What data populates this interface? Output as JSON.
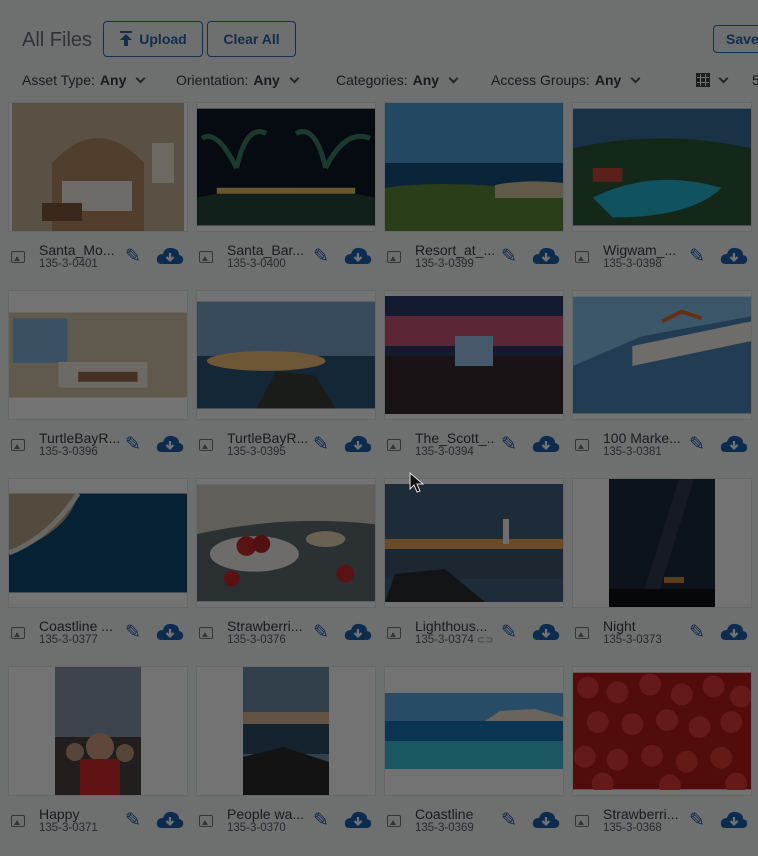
{
  "header": {
    "title": "All Files",
    "upload_label": "Upload",
    "clear_label": "Clear All",
    "save_label": "Save"
  },
  "filters": [
    {
      "label": "Asset Type:",
      "value": "Any"
    },
    {
      "label": "Orientation:",
      "value": "Any"
    },
    {
      "label": "Categories:",
      "value": "Any"
    },
    {
      "label": "Access Groups:",
      "value": "Any"
    }
  ],
  "view": {
    "icon": "grid-icon",
    "per_page": "5"
  },
  "colors": {
    "accent": "#1e5fae",
    "overlay": "rgba(0,0,0,0.55)"
  },
  "files": [
    {
      "name": "Santa_Mo...",
      "code": "135-3-0401"
    },
    {
      "name": "Santa_Bar...",
      "code": "135-3-0400"
    },
    {
      "name": "Resort_at_...",
      "code": "135-3-0399"
    },
    {
      "name": "Wigwam_...",
      "code": "135-3-0398"
    },
    {
      "name": "TurtleBayR...",
      "code": "135-3-0396"
    },
    {
      "name": "TurtleBayR...",
      "code": "135-3-0395"
    },
    {
      "name": "The_Scott_...",
      "code": "135-3-0394"
    },
    {
      "name": "100 Marke...",
      "code": "135-3-0381"
    },
    {
      "name": "Coastline ...",
      "code": "135-3-0377"
    },
    {
      "name": "Strawberri...",
      "code": "135-3-0376"
    },
    {
      "name": "Lighthous...",
      "code": "135-3-0374"
    },
    {
      "name": "Night",
      "code": "135-3-0373"
    },
    {
      "name": "Happy",
      "code": "135-3-0371"
    },
    {
      "name": "People wa...",
      "code": "135-3-0370"
    },
    {
      "name": "Coastline",
      "code": "135-3-0369"
    },
    {
      "name": "Strawberri...",
      "code": "135-3-0368"
    }
  ]
}
